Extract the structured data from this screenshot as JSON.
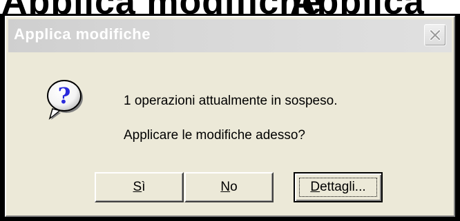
{
  "background": {
    "word_left": "Applica modifiche",
    "word_right": "Applica"
  },
  "dialog": {
    "title": "Applica modifiche",
    "close_icon": "close-icon",
    "icon": "question-icon",
    "message_line1": "1 operazioni attualmente in sospeso.",
    "message_line2": "Applicare le modifiche adesso?"
  },
  "buttons": {
    "yes": {
      "mnemonic": "S",
      "rest": "ì"
    },
    "no": {
      "mnemonic": "N",
      "rest": "o"
    },
    "details": {
      "mnemonic": "D",
      "rest": "ettagli..."
    }
  }
}
